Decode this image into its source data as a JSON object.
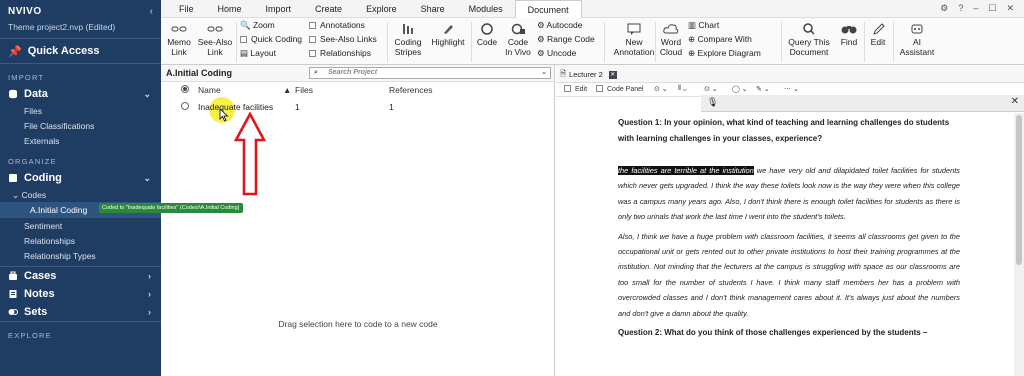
{
  "app": {
    "brand": "NVIVO",
    "project_name": "Theme project2.nvp (Edited)"
  },
  "sidebar": {
    "quick_access": "Quick Access",
    "sections": {
      "import": "IMPORT",
      "organize": "ORGANIZE",
      "explore": "EXPLORE"
    },
    "data": {
      "label": "Data",
      "items": [
        "Files",
        "File Classifications",
        "Externals"
      ]
    },
    "coding": {
      "label": "Coding",
      "codes_label": "Codes",
      "selected_code": "A.Initial Coding",
      "items": [
        "Sentiment",
        "Relationships",
        "Relationship Types"
      ]
    },
    "cases": "Cases",
    "notes": "Notes",
    "sets": "Sets",
    "tooltip": "Coded to \"Inadequate facilities\" (Codes\\\\A.Initial Coding)"
  },
  "ribbon": {
    "tabs": [
      "File",
      "Home",
      "Import",
      "Create",
      "Explore",
      "Share",
      "Modules",
      "Document"
    ],
    "active_tab": "Document",
    "memo_link": "Memo\nLink",
    "see_also_link": "See-Also\nLink",
    "zoom": "Zoom",
    "quick_coding": "Quick Coding",
    "layout": "Layout",
    "annotations": "Annotations",
    "see_also_links": "See-Also Links",
    "relationships": "Relationships",
    "coding_stripes": "Coding\nStripes",
    "highlight": "Highlight",
    "code": "Code",
    "code_in_vivo": "Code\nIn Vivo",
    "autocode": "Autocode",
    "range_code": "Range Code",
    "uncode": "Uncode",
    "new_annotation": "New\nAnnotation",
    "word_cloud": "Word\nCloud",
    "chart": "Chart",
    "compare_with": "Compare With",
    "explore_diagram": "Explore Diagram",
    "query_this_document": "Query This\nDocument",
    "find": "Find",
    "edit": "Edit",
    "ai_assistant": "AI\nAssistant"
  },
  "list_view": {
    "title": "A.Initial Coding",
    "search_placeholder": "Search Project",
    "columns": {
      "name": "Name",
      "files": "Files",
      "references": "References"
    },
    "rows": [
      {
        "name": "Inadequate facilities",
        "files": "1",
        "references": "1"
      }
    ],
    "drag_hint": "Drag selection here to code to a new code"
  },
  "document": {
    "tab_label": "Lecturer 2",
    "toolbar": {
      "edit": "Edit",
      "code_panel": "Code Panel"
    },
    "question1": "Question 1: In your opinion, what kind of teaching and learning challenges do students with learning challenges in your classes, experience?",
    "selected_text": "the facilities are terrible at the institution",
    "para1_rest": " we have very old and dilapidated toilet facilities for students which never gets upgraded. I think the way these toilets look now is the way they were when this college was a campus many years ago. Also, I don't think there is enough toilet facilities for students as there is only two urinals that work the last time I went into the student's toilets.",
    "para2": "Also, I think we have a huge problem with classroom facilities, it seems all classrooms get given to the occupational unit or gets rented out to other private institutions to host their training programmes at the institution. Not minding that the lecturers at the campus is struggling with space as our classrooms are too small for the number of students I have. I think many staff members her has a problem with overcrowded classes and I don't think management cares about it. It's always just about the numbers and don't give a damn about the quality.",
    "question2": "Question 2: What do you think of those challenges experienced by the students –"
  },
  "colors": {
    "sidebar_bg": "#1f3d63",
    "selection_bg": "#111111",
    "tooltip_bg": "#2a8a3b",
    "annotation_arrow": "#e0151b",
    "cursor_highlight": "#f5ee28"
  }
}
